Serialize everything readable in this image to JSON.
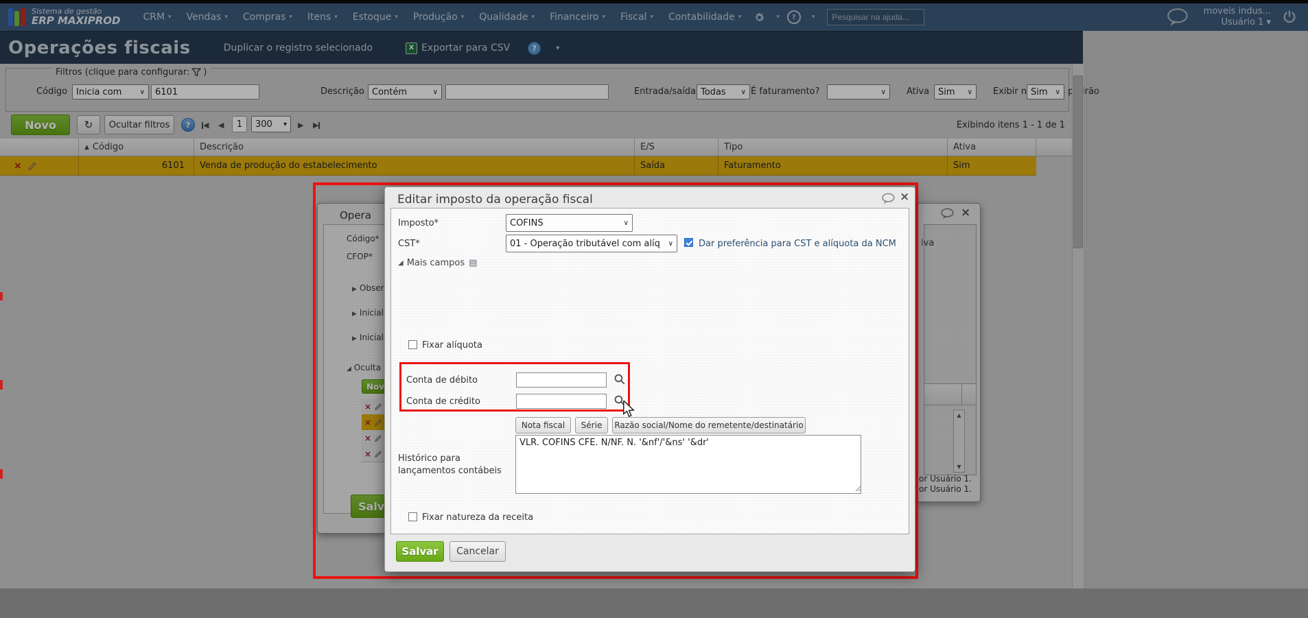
{
  "navbar": {
    "brand_top": "Sistema de gestão",
    "brand_bottom": "ERP MAXIPROD",
    "menus": [
      "CRM",
      "Vendas",
      "Compras",
      "Itens",
      "Estoque",
      "Produção",
      "Qualidade",
      "Financeiro",
      "Fiscal",
      "Contabilidade"
    ],
    "search_placeholder": "Pesquisar na ajuda...",
    "account_company": "moveis indus...",
    "account_user": "Usuário 1"
  },
  "page_header": {
    "title": "Operações fiscais",
    "action_duplicate": "Duplicar o registro selecionado",
    "action_export": "Exportar para CSV",
    "excel_icon_letter": "X"
  },
  "filters": {
    "legend_prefix": "Filtros (clique para configurar:",
    "legend_suffix": ")",
    "codigo": {
      "label": "Código",
      "operator": "Inicia com",
      "value": "6101"
    },
    "descricao": {
      "label": "Descrição",
      "operator": "Contém",
      "value": ""
    },
    "entrada_saida": {
      "label": "Entrada/saída",
      "value": "Todas"
    },
    "faturamento": {
      "label": "É faturamento?",
      "value": ""
    },
    "ativa": {
      "label": "Ativa",
      "value": "Sim"
    },
    "naturezas": {
      "label": "Exibir naturezas padrão",
      "value": "Sim"
    }
  },
  "toolbar": {
    "novo": "Novo",
    "ocultar_filtros": "Ocultar filtros",
    "help": "?",
    "page_number": "1",
    "page_size": "300",
    "status": "Exibindo itens 1 - 1 de 1"
  },
  "grid": {
    "columns": [
      "Código",
      "Descrição",
      "E/S",
      "Tipo",
      "Ativa"
    ],
    "row": {
      "codigo": "6101",
      "descricao": "Venda de produção do estabelecimento",
      "es": "Saída",
      "tipo": "Faturamento",
      "ativa": "Sim"
    }
  },
  "left_dialog": {
    "title": "Opera",
    "codigo_label": "Código*",
    "cfop_label": "CFOP*",
    "sections": [
      "Obser",
      "Iniciali",
      "Iniciali",
      "Oculta"
    ],
    "novo_btn": "Nov",
    "salvar_btn": "Salvar"
  },
  "right_dialog": {
    "ativa_fragment": "iva",
    "audit_line1": "or Usuário 1.",
    "audit_line2": "or Usuário 1."
  },
  "modal": {
    "title": "Editar imposto da operação fiscal",
    "imposto_label": "Imposto*",
    "imposto_value": "COFINS",
    "cst_label": "CST*",
    "cst_value": "01 - Operação tributável com alíq",
    "pref_ncm_label": "Dar preferência para CST e alíquota da NCM",
    "mais_campos": "Mais campos",
    "fixar_aliquota": "Fixar alíquota",
    "conta_debito_label": "Conta de débito",
    "conta_debito_value": "",
    "conta_credito_label": "Conta de crédito",
    "conta_credito_value": "",
    "token_buttons": [
      "Nota fiscal",
      "Série",
      "Razão social/Nome do remetente/destinatário"
    ],
    "historico_label": "Histórico para lançamentos contábeis",
    "historico_value": "VLR. COFINS CFE. N/NF. N. '&nf'/'&ns' '&dr'",
    "fixar_natureza": "Fixar natureza da receita",
    "salvar": "Salvar",
    "cancelar": "Cancelar"
  },
  "icons": {
    "caret_down": "▾",
    "select_caret": "∨",
    "sort_asc": "▲",
    "expander_collapsed": "▶",
    "expander_expanded": "◢",
    "close": "×",
    "refresh": "↻",
    "prev": "◀",
    "next": "▶",
    "delete_x": "×",
    "grid_small": "▤",
    "scroll_up": "▲",
    "scroll_down": "▼",
    "help_mark": "?"
  },
  "colors": {
    "annotation_red": "#ec1212",
    "accent_green": "#76b20e",
    "selected_row_gold": "#dfae10",
    "navbar_blue": "#3d5c7d",
    "header_slate": "#273c51",
    "checkbox_blue": "#3f83e0"
  }
}
